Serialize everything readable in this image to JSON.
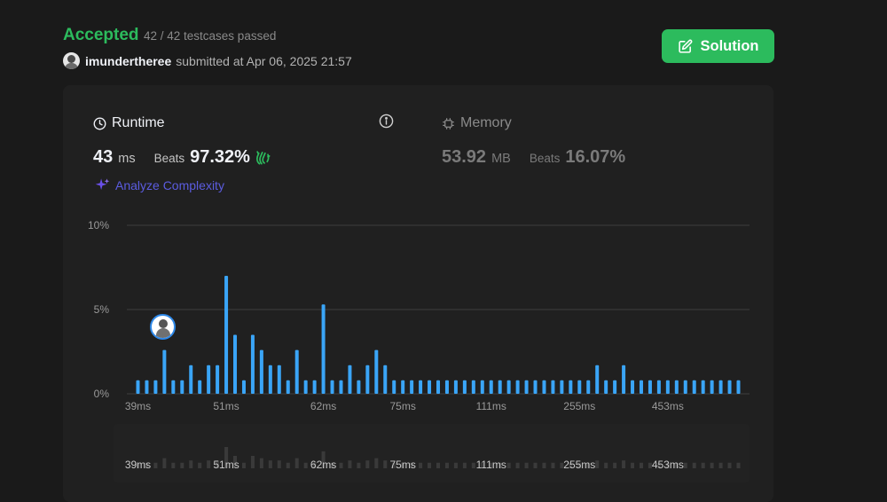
{
  "status": {
    "label": "Accepted",
    "testcases": "42 / 42 testcases passed"
  },
  "submission": {
    "username": "imundertheree",
    "submitted_text": "submitted at Apr 06, 2025 21:57"
  },
  "solution_button": {
    "label": "Solution"
  },
  "runtime": {
    "title": "Runtime",
    "value": "43",
    "unit": "ms",
    "beats_label": "Beats",
    "beats_pct": "97.32%"
  },
  "memory": {
    "title": "Memory",
    "value": "53.92",
    "unit": "MB",
    "beats_label": "Beats",
    "beats_pct": "16.07%"
  },
  "analyze_label": "Analyze Complexity",
  "colors": {
    "accent_green": "#2cbb5d",
    "bar_blue": "#3aa5f7",
    "analyze_purple": "#5b5ce0"
  },
  "chart_data": {
    "type": "bar",
    "ylabel_ticks": [
      "10%",
      "5%",
      "0%"
    ],
    "ylim": [
      0,
      10
    ],
    "categories": [
      "39ms",
      "",
      "",
      "",
      "51ms",
      "",
      "",
      "",
      "62ms",
      "",
      "",
      "",
      "75ms",
      "",
      "",
      "",
      "111ms",
      "",
      "",
      "",
      "255ms",
      "",
      "",
      "",
      "453ms",
      "",
      ""
    ],
    "x_tick_labels": [
      "39ms",
      "51ms",
      "62ms",
      "75ms",
      "111ms",
      "255ms",
      "453ms"
    ],
    "values": [
      0.8,
      0.8,
      0.8,
      2.6,
      0.8,
      0.8,
      1.7,
      0.8,
      1.7,
      1.7,
      7.0,
      3.5,
      0.8,
      3.5,
      2.6,
      1.7,
      1.7,
      0.8,
      2.6,
      0.8,
      0.8,
      5.3,
      0.8,
      0.8,
      1.7,
      0.8,
      1.7,
      2.6,
      1.7,
      0.8,
      0.8,
      0.8,
      0.8,
      0.8,
      0.8,
      0.8,
      0.8,
      0.8,
      0.8,
      0.8,
      0.8,
      0.8,
      0.8,
      0.8,
      0.8,
      0.8,
      0.8,
      0.8,
      0.8,
      0.8,
      0.8,
      0.8,
      1.7,
      0.8,
      0.8,
      1.7,
      0.8,
      0.8,
      0.8,
      0.8,
      0.8,
      0.8,
      0.8,
      0.8,
      0.8,
      0.8,
      0.8,
      0.8,
      0.8
    ],
    "highlight_index": 3,
    "grid": true
  }
}
